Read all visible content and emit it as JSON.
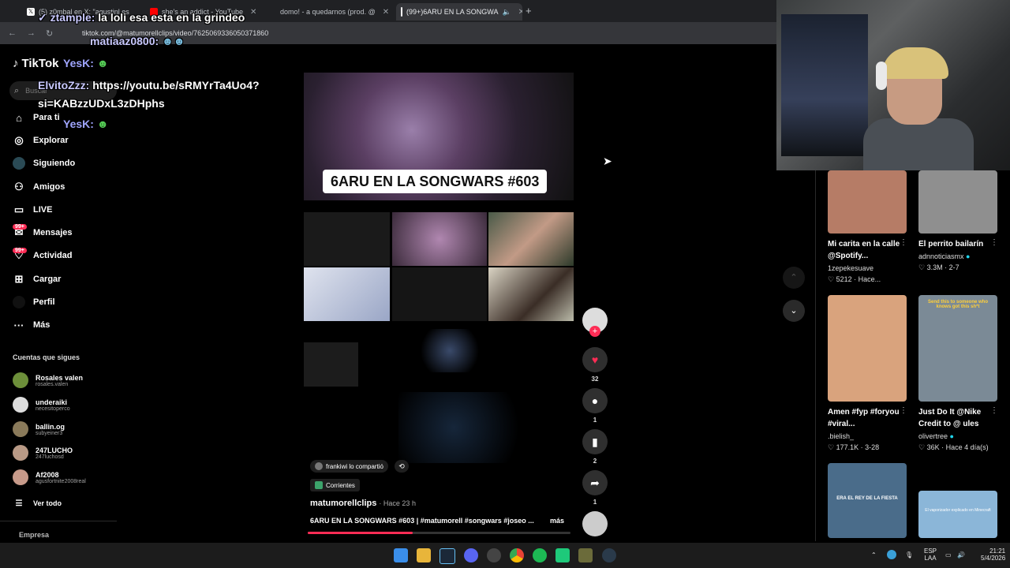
{
  "browser": {
    "tabs": [
      {
        "label": "(5) z0mbal en X: \"agustinl es",
        "favicon_color": "#000000"
      },
      {
        "label": "she's an addict - YouTube",
        "favicon_color": "#ff0000"
      },
      {
        "label": "domo! - a quedarnos (prod. @",
        "favicon_color": "#ff0000"
      },
      {
        "label": "(99+)6ARU EN LA SONGWA",
        "favicon_color": "#111111"
      }
    ],
    "url": "tiktok.com/@matumorellclips/video/7625069336050371860"
  },
  "chat_overlay": {
    "line1_user": "✓ ztample:",
    "line1_text": "la loli esa esta en la grindeo",
    "line2_user": "matiaaz0800:",
    "line3_user": "YesK:",
    "line4_user": "ElvitoZzz:",
    "line4_text": "https://youtu.be/sRMYrTa4Uo4?",
    "line4_text2": "si=KABzzUDxL3zDHphs",
    "line5_user": "YesK:"
  },
  "sidebar": {
    "logo": "TikTok",
    "search_placeholder": "Buscar",
    "nav": [
      {
        "label": "Para ti",
        "icon": "home-icon"
      },
      {
        "label": "Explorar",
        "icon": "compass-icon"
      },
      {
        "label": "Siguiendo",
        "icon": "following-icon"
      },
      {
        "label": "Amigos",
        "icon": "friends-icon"
      },
      {
        "label": "LIVE",
        "icon": "live-icon"
      },
      {
        "label": "Mensajes",
        "icon": "messages-icon"
      },
      {
        "label": "Actividad",
        "icon": "activity-icon"
      },
      {
        "label": "Cargar",
        "icon": "upload-icon"
      },
      {
        "label": "Perfil",
        "icon": "profile-icon"
      },
      {
        "label": "Más",
        "icon": "more-icon"
      }
    ],
    "badge_messages": "99+",
    "badge_activity": "99+",
    "following_title": "Cuentas que sigues",
    "following": [
      {
        "name": "Rosales valen",
        "handle": "rosales.valen"
      },
      {
        "name": "underaiki",
        "handle": "necesitoperco"
      },
      {
        "name": "ballin.og",
        "handle": "subyeiner3"
      },
      {
        "name": "247LUCHO",
        "handle": "247luchosd"
      },
      {
        "name": "Af2008",
        "handle": "agusfortnite2008real"
      }
    ],
    "see_all": "Ver todo",
    "company": "Empresa"
  },
  "video": {
    "title_overlay": "6ARU EN LA SONGWARS #603",
    "shared_by": "frankiwi lo compartió",
    "category": "Corrientes",
    "author": "matumorellclips",
    "time": "· Hace 23 h",
    "caption": "6ARU EN LA SONGWARS #603 | #matumorell #songwars #joseo ...",
    "more": "más",
    "progress": 0.4
  },
  "actions": {
    "likes": "32",
    "comments": "1",
    "saves": "2",
    "shares": "1"
  },
  "recommended": [
    {
      "title": "Mi carita en la calle @Spotify...",
      "user": "1zepekesuave",
      "meta": "♡ 5212 · Hace...",
      "color": "#b67c66"
    },
    {
      "title": "El perrito bailarín",
      "user": "adnnoticiasmx",
      "meta": "♡ 3.3M · 2-7",
      "color": "#8f8f8f"
    },
    {
      "title": "Amen #fyp #foryou #viral...",
      "user": ".bielish_",
      "meta": "♡ 177.1K · 3-28",
      "color": "#d9a37d"
    },
    {
      "title": "Just Do It @Nike Credit to @ ules",
      "user": "olivertree",
      "meta": "♡ 36K · Hace 4 día(s)",
      "color": "#7b8a96"
    },
    {
      "title": "",
      "user": "",
      "meta": "",
      "color": "#4a6c8a",
      "overlay": "ERA EL REY DE LA FIESTA"
    },
    {
      "title": "",
      "user": "",
      "meta": "",
      "color": "#8bb6d8",
      "overlay": "El vaporizador explicado en Minecraft"
    }
  ],
  "recommended_overlay_4": "Send this to someone who knows got this sh*t",
  "taskbar": {
    "lang": "ESP",
    "region": "LAA",
    "time": "21:21",
    "date": "5/4/2026"
  }
}
